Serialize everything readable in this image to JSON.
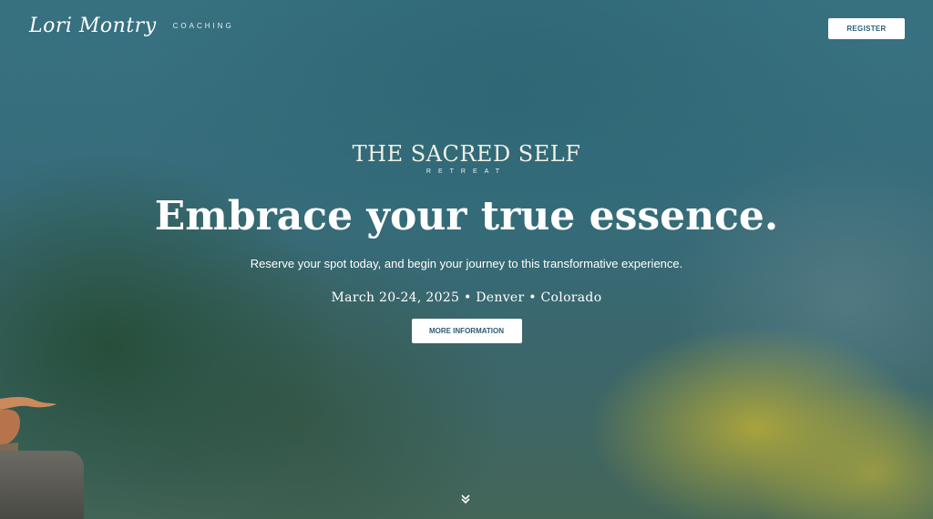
{
  "header": {
    "logo_script": "Lori Montry",
    "logo_sub": "COACHING",
    "register_label": "REGISTER"
  },
  "hero": {
    "brand_title": "THE SACRED SELF",
    "brand_sub": "RETREAT",
    "headline": "Embrace your true essence.",
    "subtext": "Reserve your spot today, and begin your journey to this transformative experience.",
    "event_details": "March 20-24, 2025 • Denver • Colorado",
    "more_label": "MORE INFORMATION"
  },
  "icons": {
    "scroll": "chevron-double-down-icon"
  },
  "colors": {
    "button_text": "#2f5b75",
    "button_bg": "#ffffff",
    "title_cream": "#f3efe4"
  }
}
